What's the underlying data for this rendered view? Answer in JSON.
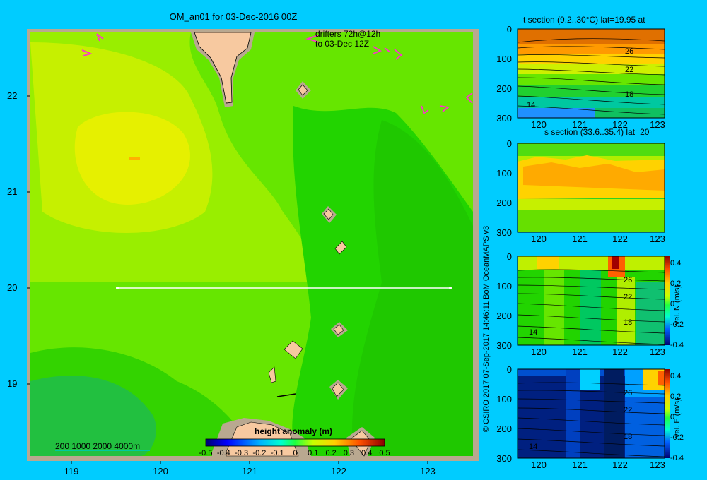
{
  "title": "OM_an01 for 03-Dec-2016 00Z",
  "drifters_label": [
    "drifters 72h@12h",
    "to 03-Dec 12Z"
  ],
  "credit": "© CSIRO 2017   07-Sep-2017 14:46:11 BoM OceanMAPS v3",
  "scale_label": "200  1000  2000  4000m",
  "colors": {
    "background": "#00ccff",
    "drifter": "#ff33cc",
    "land": "#f7c9a0",
    "shelf": "#b9a890",
    "section_line": "#ffffff"
  },
  "chart_data": [
    {
      "type": "heatmap",
      "name": "main-map",
      "variable": "height anomaly (m)",
      "x_ticks": [
        "119",
        "120",
        "121",
        "122",
        "123"
      ],
      "y_ticks": [
        "22",
        "21",
        "20",
        "19"
      ],
      "xlim": [
        118.5,
        123.5
      ],
      "ylim": [
        18.3,
        22.7
      ],
      "colorbar": {
        "label": "height anomaly (m)",
        "range": [
          -0.5,
          0.5
        ],
        "ticks": [
          "-0.5",
          "-0.4",
          "-0.3",
          "-0.2",
          "-0.1",
          "0",
          "0.1",
          "0.2",
          "0.3",
          "0.4",
          "0.5"
        ]
      },
      "section_line": {
        "lat": 20.0,
        "lon_start": 119.5,
        "lon_end": 123.2
      }
    },
    {
      "type": "heatmap",
      "name": "temperature-section",
      "title": "t section (9.2..30°C) lat=19.95 at",
      "x_ticks": [
        "120",
        "121",
        "122",
        "123"
      ],
      "y_ticks": [
        "0",
        "100",
        "200",
        "300"
      ],
      "contour_labels": [
        "26",
        "22",
        "18",
        "14"
      ]
    },
    {
      "type": "heatmap",
      "name": "salinity-section",
      "title": "s section (33.6..35.4) lat=20",
      "x_ticks": [
        "120",
        "121",
        "122",
        "123"
      ],
      "y_ticks": [
        "0",
        "100",
        "200",
        "300"
      ]
    },
    {
      "type": "heatmap",
      "name": "velocity-north-section",
      "x_ticks": [
        "120",
        "121",
        "122",
        "123"
      ],
      "y_ticks": [
        "0",
        "100",
        "200",
        "300"
      ],
      "contour_labels": [
        "26",
        "22",
        "18",
        "14"
      ],
      "colorbar": {
        "label": "vel. N (m/s)",
        "ticks": [
          "0.4",
          "0.2",
          "0",
          "-0.2",
          "-0.4"
        ]
      }
    },
    {
      "type": "heatmap",
      "name": "velocity-east-section",
      "x_ticks": [
        "120",
        "121",
        "122",
        "123"
      ],
      "y_ticks": [
        "0",
        "100",
        "200",
        "300"
      ],
      "contour_labels": [
        "26",
        "22",
        "18",
        "14"
      ],
      "colorbar": {
        "label": "vel. E (m/s)",
        "ticks": [
          "0.4",
          "0.2",
          "0",
          "-0.2",
          "-0.4"
        ]
      }
    }
  ]
}
